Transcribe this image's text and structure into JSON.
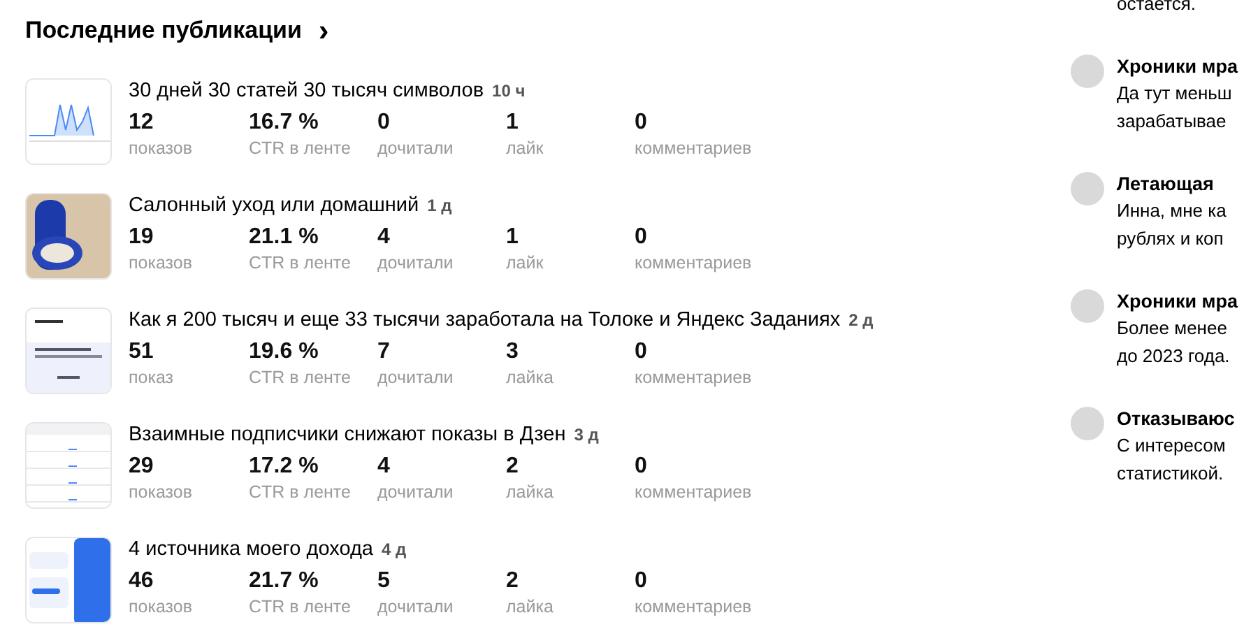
{
  "section": {
    "title": "Последние публикации",
    "chevron": "›"
  },
  "publications": [
    {
      "kind": "chart",
      "title": "30 дней 30 статей 30 тысяч символов",
      "age": "10 ч",
      "stats": [
        {
          "value": "12",
          "label": "показов"
        },
        {
          "value": "16.7 %",
          "label": "CTR в ленте"
        },
        {
          "value": "0",
          "label": "дочитали"
        },
        {
          "value": "1",
          "label": "лайк"
        },
        {
          "value": "0",
          "label": "комментариев"
        }
      ]
    },
    {
      "kind": "photo",
      "title": "Салонный уход или домашний",
      "age": "1 д",
      "stats": [
        {
          "value": "19",
          "label": "показов"
        },
        {
          "value": "21.1 %",
          "label": "CTR в ленте"
        },
        {
          "value": "4",
          "label": "дочитали"
        },
        {
          "value": "1",
          "label": "лайк"
        },
        {
          "value": "0",
          "label": "комментариев"
        }
      ]
    },
    {
      "kind": "document",
      "title": "Как я 200 тысяч и еще 33 тысячи заработала на Толоке и Яндекс Заданиях",
      "age": "2 д",
      "stats": [
        {
          "value": "51",
          "label": "показ"
        },
        {
          "value": "19.6 %",
          "label": "CTR в ленте"
        },
        {
          "value": "7",
          "label": "дочитали"
        },
        {
          "value": "3",
          "label": "лайка"
        },
        {
          "value": "0",
          "label": "комментариев"
        }
      ]
    },
    {
      "kind": "table",
      "title": "Взаимные подписчики снижают показы в Дзен",
      "age": "3 д",
      "stats": [
        {
          "value": "29",
          "label": "показов"
        },
        {
          "value": "17.2 %",
          "label": "CTR в ленте"
        },
        {
          "value": "4",
          "label": "дочитали"
        },
        {
          "value": "2",
          "label": "лайка"
        },
        {
          "value": "0",
          "label": "комментариев"
        }
      ]
    },
    {
      "kind": "app",
      "title": "4 источника моего дохода",
      "age": "4 д",
      "stats": [
        {
          "value": "46",
          "label": "показов"
        },
        {
          "value": "21.7 %",
          "label": "CTR в ленте"
        },
        {
          "value": "5",
          "label": "дочитали"
        },
        {
          "value": "2",
          "label": "лайка"
        },
        {
          "value": "0",
          "label": "комментариев"
        }
      ]
    }
  ],
  "comments_top_text": "остается.",
  "comments": [
    {
      "author": "Хроники мра",
      "lines": [
        "Да тут меньш",
        "зарабатывае"
      ]
    },
    {
      "author": "Летающая",
      "lines": [
        "Инна, мне ка",
        "рублях и коп"
      ]
    },
    {
      "author": "Хроники мра",
      "lines": [
        "Более менее",
        "до 2023 года."
      ]
    },
    {
      "author": "Отказываюс",
      "lines": [
        "С интересом",
        "статистикой."
      ]
    }
  ]
}
